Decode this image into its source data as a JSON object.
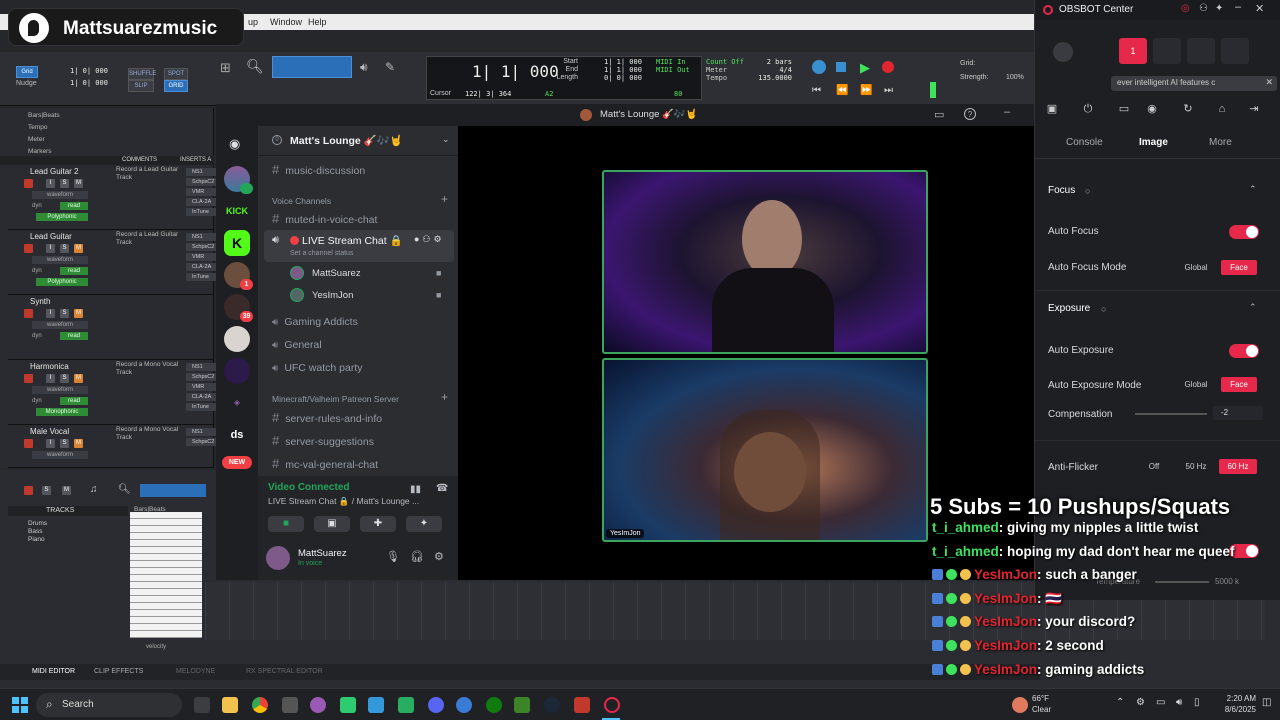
{
  "brand": {
    "name": "Mattsuarezmusic"
  },
  "daw": {
    "menus": [
      "up",
      "Window",
      "Help"
    ],
    "toolbar": {
      "grid_label": "Grid",
      "nudge_label": "Nudge",
      "grid_value": "1| 0| 000",
      "nudge_value": "1| 0| 000",
      "mode_buttons": [
        "SHUFFLE",
        "SPOT",
        "SLIP",
        "GRID"
      ],
      "counter_main": "1| 1| 000",
      "start_label": "Start",
      "end_label": "End",
      "length_label": "Length",
      "start_value": "1| 1| 000",
      "end_value": "1| 1| 000",
      "length_value": "0| 0| 000",
      "cursor_label": "Cursor",
      "cursor_value": "122| 3| 364",
      "bpm_label": "A2",
      "midi_in": "MIDI In",
      "midi_out": "MIDI Out",
      "count_off": "Count Off",
      "meter_label": "Meter",
      "tempo_label": "Tempo",
      "bars": "2 bars",
      "meter_value": "4/4",
      "tempo_value": "135.0000",
      "grid_right_label": "Grid:",
      "strength_label": "Strength:",
      "strength_value": "100%",
      "level_value": "80"
    },
    "ruler": [
      "Bars|Beats",
      "Tempo",
      "Meter",
      "Markers"
    ],
    "headers": {
      "comments": "COMMENTS",
      "inserts": "INSERTS A"
    },
    "tracks": [
      {
        "name": "Lead Guitar 2",
        "comment": "Record a Lead Guitar Track",
        "view": "waveform",
        "plugin": "Polyphonic",
        "inserts": [
          "NS1",
          "SchpsC2",
          "VMR",
          "CLA-2A",
          "InTune"
        ]
      },
      {
        "name": "Lead Guitar",
        "comment": "Record a Lead Guitar Track",
        "view": "waveform",
        "plugin": "Polyphonic",
        "inserts": [
          "NS1",
          "SchpsC2",
          "VMR",
          "CLA-2A",
          "InTune"
        ]
      },
      {
        "name": "Synth",
        "comment": "",
        "view": "waveform",
        "plugin": "",
        "inserts": []
      },
      {
        "name": "Harmonica",
        "comment": "Record a Mono Vocal Track",
        "view": "waveform",
        "plugin": "Monophonic",
        "inserts": [
          "NS1",
          "SchpsC2",
          "VMR",
          "CLA-2A",
          "InTune"
        ]
      },
      {
        "name": "Male Vocal",
        "comment": "Record a Mono Vocal Track",
        "view": "waveform",
        "plugin": "",
        "inserts": [
          "NS1",
          "SchpsC2"
        ]
      }
    ],
    "dyn": "dyn",
    "read": "read",
    "midi_panel": {
      "tracks_label": "TRACKS",
      "items": [
        "Drums",
        "Bass",
        "Piano"
      ],
      "ruler": "Bars|Beats",
      "velocity": "velocity"
    },
    "bottom_tabs": [
      "MIDI EDITOR",
      "CLIP EFFECTS",
      "MELODYNE",
      "RX SPECTRAL EDITOR"
    ]
  },
  "discord": {
    "title": "Matt's Lounge 🎸🎶🤘",
    "server_name": "Matt's Lounge 🎸🎶🤘",
    "servers": [
      {
        "label": "",
        "badge": ""
      },
      {
        "label": "KICK",
        "badge": ""
      },
      {
        "label": "K",
        "badge": ""
      },
      {
        "label": "",
        "badge": "1"
      },
      {
        "label": "",
        "badge": "39"
      },
      {
        "label": "",
        "badge": ""
      },
      {
        "label": "",
        "badge": ""
      },
      {
        "label": "",
        "badge": ""
      },
      {
        "label": "ds",
        "badge": ""
      },
      {
        "label": "NEW",
        "badge": ""
      }
    ],
    "channels": {
      "top": "music-discussion",
      "voice_category": "Voice Channels",
      "muted": "muted-in-voice-chat",
      "live": "LIVE Stream Chat 🔒",
      "status": "Set a channel status",
      "members": [
        "MattSuarez",
        "YesImJon"
      ],
      "others": [
        "Gaming Addicts",
        "General",
        "UFC watch party"
      ],
      "patreon_category": "Minecraft/Valheim Patreon Server",
      "patreon": [
        "server-rules-and-info",
        "server-suggestions",
        "mc-val-general-chat"
      ]
    },
    "voice_panel": {
      "status": "Video Connected",
      "channel": "LIVE Stream Chat 🔒 / Matt's Lounge ...",
      "user": "MattSuarez",
      "user_status": "In voice"
    },
    "video": {
      "cam2_label": "YesImJon"
    }
  },
  "obsbot": {
    "title": "OBSBOT Center",
    "presets": [
      "1"
    ],
    "banner": "ever intelligent AI features c",
    "tabs": [
      "Console",
      "Image",
      "More"
    ],
    "active_tab": "Image",
    "focus": {
      "title": "Focus",
      "auto_focus": "Auto Focus",
      "auto_focus_mode": "Auto Focus Mode",
      "mode_options": [
        "Global",
        "Face"
      ]
    },
    "exposure": {
      "title": "Exposure",
      "auto_exposure": "Auto Exposure",
      "auto_exposure_mode": "Auto Exposure Mode",
      "mode_options": [
        "Global",
        "Face"
      ],
      "compensation": "Compensation",
      "compensation_value": "-2",
      "compensation_level": 0.45
    },
    "anti_flicker": {
      "label": "Anti-Flicker",
      "options": [
        "Off",
        "50 Hz",
        "60 Hz"
      ]
    },
    "temperature": {
      "label": "Temperature",
      "value": "5000 k"
    },
    "colors": {
      "accent": "#e6284a"
    }
  },
  "overlay": {
    "goal": "5 Subs = 10 Pushups/Squats",
    "chat": [
      {
        "user": "t_i_ahmed",
        "msg": ": giving my nipples a little twist",
        "color": "green"
      },
      {
        "user": "t_i_ahmed",
        "msg": ": hoping my dad don't hear me queef",
        "color": "green"
      },
      {
        "user": "YesImJon",
        "msg": ": such a banger",
        "color": "red"
      },
      {
        "user": "YesImJon",
        "msg": ": 🇹🇭",
        "color": "red"
      },
      {
        "user": "YesImJon",
        "msg": ": your discord?",
        "color": "red"
      },
      {
        "user": "YesImJon",
        "msg": ": 2 second",
        "color": "red"
      },
      {
        "user": "YesImJon",
        "msg": ": gaming addicts",
        "color": "red"
      }
    ]
  },
  "taskbar": {
    "search": "Search",
    "weather_temp": "66°F",
    "weather_desc": "Clear",
    "time": "2:20 AM",
    "date": "8/6/2025"
  }
}
